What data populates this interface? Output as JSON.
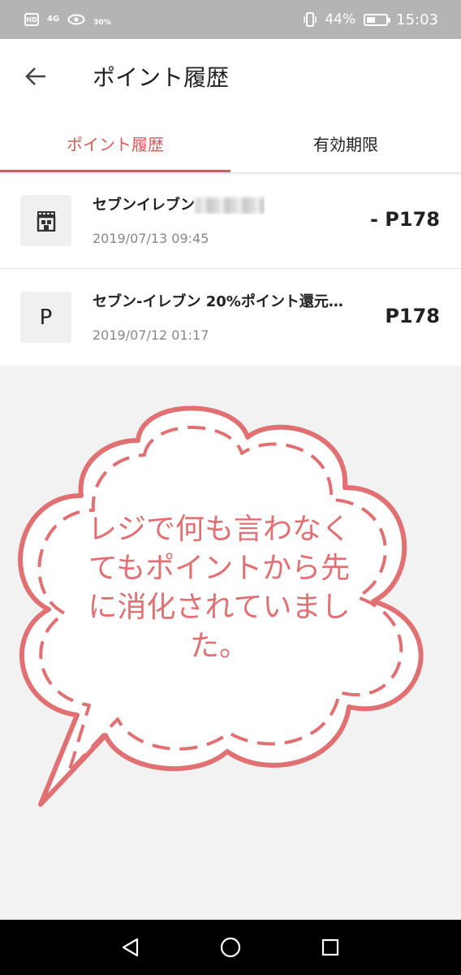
{
  "status_bar": {
    "hd": "HD",
    "network": "4G",
    "data_saver_pct": "30%",
    "battery_pct": "44%",
    "battery_level": 0.44,
    "time": "15:03"
  },
  "appbar": {
    "title": "ポイント履歴",
    "back_icon": "arrow-left-icon"
  },
  "tabs": [
    {
      "label": "ポイント履歴",
      "active": true
    },
    {
      "label": "有効期限",
      "active": false
    }
  ],
  "history": [
    {
      "icon": "store-icon",
      "icon_text": "",
      "title": "セブンイレブン",
      "title_obscured": true,
      "date": "2019/07/13 09:45",
      "points": "- P178"
    },
    {
      "icon": "points-p-icon",
      "icon_text": "P",
      "title": "セブン-イレブン 20%ポイント還元…",
      "title_obscured": false,
      "date": "2019/07/12 01:17",
      "points": "P178"
    }
  ],
  "annotation": {
    "text": "レジで何も言わなくてもポイントから先に消化されていました。",
    "color": "#e07072"
  },
  "colors": {
    "accent": "#d65a57",
    "status_bar_bg": "#b4b4b4",
    "page_bg": "#f2f2f2",
    "nav_bar_bg": "#000000"
  },
  "nav_bar": [
    "back-triangle-icon",
    "home-circle-icon",
    "recents-square-icon"
  ]
}
